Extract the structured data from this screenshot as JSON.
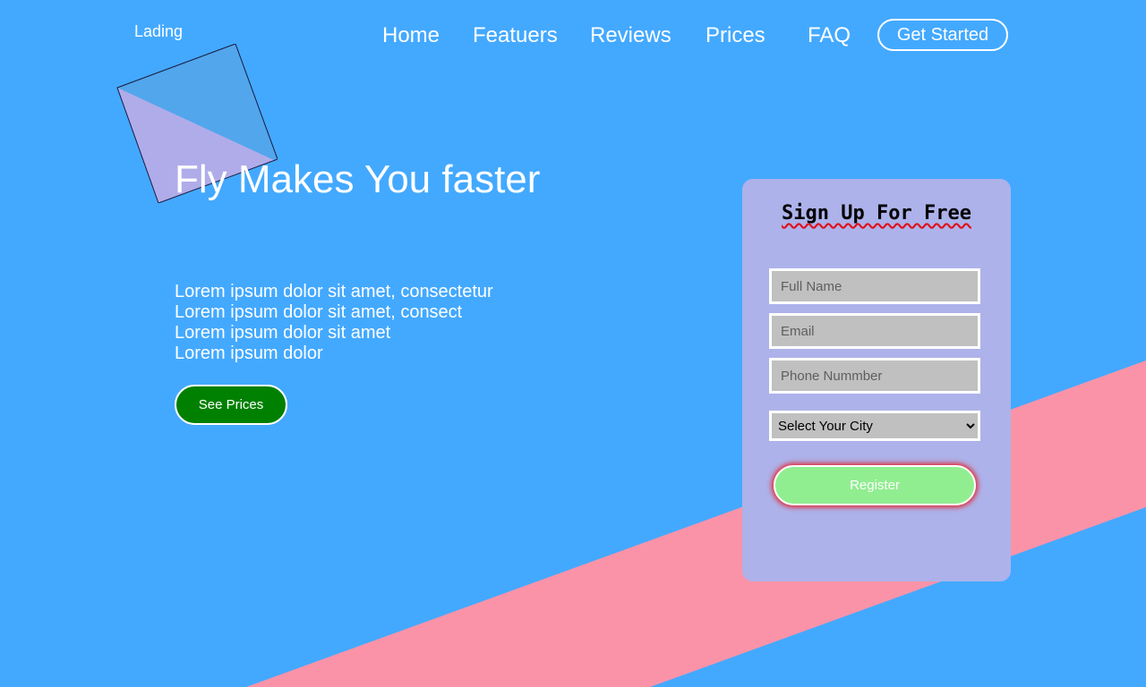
{
  "app": {
    "brand": "Lading"
  },
  "nav": {
    "items": [
      {
        "label": "Home"
      },
      {
        "label": "Featuers"
      },
      {
        "label": "Reviews"
      },
      {
        "label": "Prices"
      },
      {
        "label": "FAQ"
      }
    ],
    "cta_label": "Get Started"
  },
  "hero": {
    "title": "Fly Makes You faster",
    "lines": [
      "Lorem ipsum dolor sit amet, consectetur",
      "Lorem ipsum dolor sit amet, consect",
      "Lorem ipsum dolor sit amet",
      "Lorem ipsum dolor"
    ],
    "button_label": "See Prices"
  },
  "signup": {
    "title": "Sign Up For Free",
    "full_name": {
      "placeholder": "Full Name",
      "value": ""
    },
    "email": {
      "placeholder": "Email",
      "value": ""
    },
    "phone": {
      "placeholder": "Phone Nummber",
      "value": ""
    },
    "city": {
      "selected": "Select Your City"
    },
    "register_label": "Register"
  },
  "colors": {
    "background": "#43a9ff",
    "stripe": "#fb93a8",
    "card": "#adb2ea",
    "see_prices_button": "#008000",
    "register_button": "#90ee90",
    "input_background": "#c0c0c0",
    "logo_light": "#b0acea",
    "logo_dark": "#52a6ec"
  },
  "icons": {
    "logo": "tilted-square-logo",
    "select_arrow": "chevron-down-icon"
  }
}
